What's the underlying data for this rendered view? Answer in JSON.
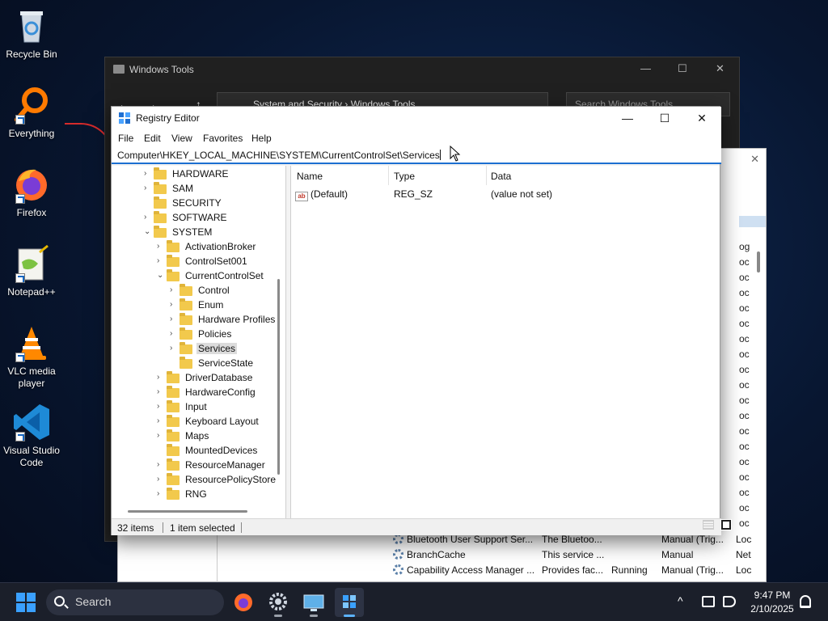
{
  "desktop": {
    "icons": [
      {
        "label": "Recycle Bin",
        "icon": "recycle-bin-icon"
      },
      {
        "label": "Everything",
        "icon": "everything-search-icon"
      },
      {
        "label": "Firefox",
        "icon": "firefox-icon"
      },
      {
        "label": "Notepad++",
        "icon": "notepadpp-icon"
      },
      {
        "label": "VLC media player",
        "icon": "vlc-icon"
      },
      {
        "label": "Visual Studio Code",
        "icon": "vscode-icon"
      }
    ]
  },
  "tools_window": {
    "title": "Windows Tools",
    "address": "System and Security  ›  Windows Tools",
    "search_placeholder": "Search Windows Tools",
    "back": "←",
    "forward": "→",
    "up": "↑",
    "minimize": "—",
    "maximize": "☐",
    "close": "✕"
  },
  "services": {
    "rows": [
      {
        "name": "Bluetooth User Support Ser...",
        "description": "The Bluetoo...",
        "status": "",
        "startup": "Manual (Trig...",
        "logon": "Loc"
      },
      {
        "name": "BranchCache",
        "description": "This service ...",
        "status": "",
        "startup": "Manual",
        "logon": "Net"
      },
      {
        "name": "Capability Access Manager ...",
        "description": "Provides fac...",
        "status": "Running",
        "startup": "Manual (Trig...",
        "logon": "Loc"
      }
    ],
    "edge_labels": [
      "og",
      "oc",
      "oc",
      "oc",
      "oc",
      "oc",
      "oc",
      "oc",
      "oc",
      "oc",
      "oc",
      "oc",
      "oc",
      "oc",
      "oc",
      "oc",
      "oc",
      "oc",
      "oc"
    ],
    "close": "✕"
  },
  "regedit": {
    "title": "Registry Editor",
    "minimize": "—",
    "maximize": "☐",
    "close": "✕",
    "menu": [
      "File",
      "Edit",
      "View",
      "Favorites",
      "Help"
    ],
    "address": "Computer\\HKEY_LOCAL_MACHINE\\SYSTEM\\CurrentControlSet\\Services",
    "tree": [
      {
        "label": "HARDWARE",
        "chevron": "›"
      },
      {
        "label": "SAM",
        "chevron": "›"
      },
      {
        "label": "SECURITY",
        "chevron": ""
      },
      {
        "label": "SOFTWARE",
        "chevron": "›"
      },
      {
        "label": "SYSTEM",
        "chevron": "⌄"
      },
      {
        "label": "ActivationBroker",
        "chevron": "›"
      },
      {
        "label": "ControlSet001",
        "chevron": "›"
      },
      {
        "label": "CurrentControlSet",
        "chevron": "⌄"
      },
      {
        "label": "Control",
        "chevron": "›"
      },
      {
        "label": "Enum",
        "chevron": "›"
      },
      {
        "label": "Hardware Profiles",
        "chevron": "›"
      },
      {
        "label": "Policies",
        "chevron": "›"
      },
      {
        "label": "Services",
        "chevron": "›"
      },
      {
        "label": "ServiceState",
        "chevron": ""
      },
      {
        "label": "DriverDatabase",
        "chevron": "›"
      },
      {
        "label": "HardwareConfig",
        "chevron": "›"
      },
      {
        "label": "Input",
        "chevron": "›"
      },
      {
        "label": "Keyboard Layout",
        "chevron": "›"
      },
      {
        "label": "Maps",
        "chevron": "›"
      },
      {
        "label": "MountedDevices",
        "chevron": ""
      },
      {
        "label": "ResourceManager",
        "chevron": "›"
      },
      {
        "label": "ResourcePolicyStore",
        "chevron": "›"
      },
      {
        "label": "RNG",
        "chevron": "›"
      }
    ],
    "columns": {
      "name": "Name",
      "type": "Type",
      "data": "Data"
    },
    "values": [
      {
        "name": "(Default)",
        "type": "REG_SZ",
        "data": "(value not set)",
        "icon_text": "ab"
      }
    ],
    "status": {
      "items": "32 items",
      "selected": "1 item selected"
    }
  },
  "taskbar": {
    "search_label": "Search",
    "apps": [
      "firefox-icon",
      "settings-gear-icon",
      "remote-desktop-icon",
      "registry-editor-icon"
    ],
    "tray_chevron": "^",
    "time": "9:47 PM",
    "date": "2/10/2025"
  }
}
